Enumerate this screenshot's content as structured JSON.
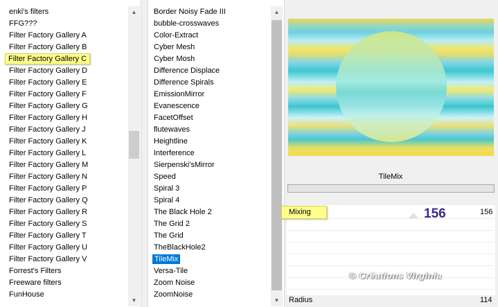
{
  "categories": {
    "items": [
      "enki's filters",
      "FFG???",
      "Filter Factory Gallery A",
      "Filter Factory Gallery B",
      "Filter Factory Gallery C",
      "Filter Factory Gallery D",
      "Filter Factory Gallery E",
      "Filter Factory Gallery F",
      "Filter Factory Gallery G",
      "Filter Factory Gallery H",
      "Filter Factory Gallery J",
      "Filter Factory Gallery K",
      "Filter Factory Gallery L",
      "Filter Factory Gallery M",
      "Filter Factory Gallery N",
      "Filter Factory Gallery P",
      "Filter Factory Gallery Q",
      "Filter Factory Gallery R",
      "Filter Factory Gallery S",
      "Filter Factory Gallery T",
      "Filter Factory Gallery U",
      "Filter Factory Gallery V",
      "Forrest's Filters",
      "Freeware filters",
      "FunHouse"
    ],
    "highlighted": "Filter Factory Gallery C"
  },
  "filters": {
    "items": [
      "Border Noisy Fade III",
      "bubble-crosswaves",
      "Color-Extract",
      "Cyber Mesh",
      "Cyber Mosh",
      "Difference Displace",
      "Difference Spirals",
      "EmissionMirror",
      "Evanescence",
      "FacetOffset",
      "flutewaves",
      "Heightline",
      "Interference",
      "Sierpenski'sMirror",
      "Speed",
      "Spiral 3",
      "Spiral 4",
      "The Black Hole 2",
      "The Grid 2",
      "The Grid",
      "TheBlackHole2",
      "TileMix",
      "Versa-Tile",
      "Zoom Noise",
      "ZoomNoise"
    ],
    "selected": "TileMix"
  },
  "filter_title": "TileMix",
  "params": {
    "mixing_label": "Mixing",
    "mixing_big": "156",
    "mixing_value": "156",
    "radius_label": "Radius",
    "radius_value": "114"
  },
  "watermark": "© Créations Virginia",
  "colors": {
    "highlight": "#ffff8c",
    "selection": "#0078d7",
    "value_text": "#3a2a8c"
  }
}
